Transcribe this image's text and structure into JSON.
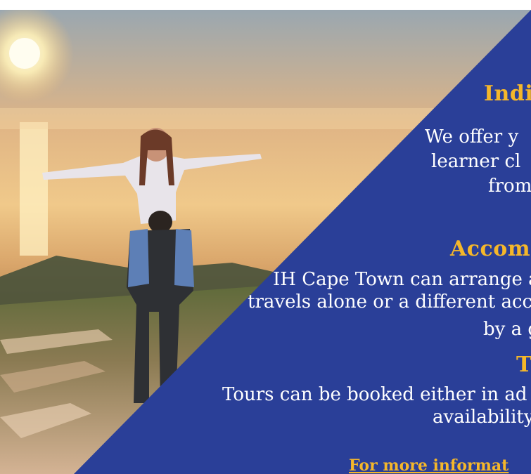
{
  "sections": [
    {
      "heading": "Indi",
      "lines": [
        "We offer y",
        "learner cl",
        "from"
      ]
    },
    {
      "heading": "Accom",
      "lines": [
        "IH Cape Town can arrange a",
        "travels alone or a different acc",
        "by a g"
      ]
    },
    {
      "heading": "T",
      "lines": [
        "Tours can be booked either in ad",
        "availability"
      ]
    }
  ],
  "more_info_link": "For more informat",
  "colors": {
    "panel_blue": "#2a3f98",
    "heading_gold": "#f5b72a",
    "text_white": "#ffffff"
  }
}
